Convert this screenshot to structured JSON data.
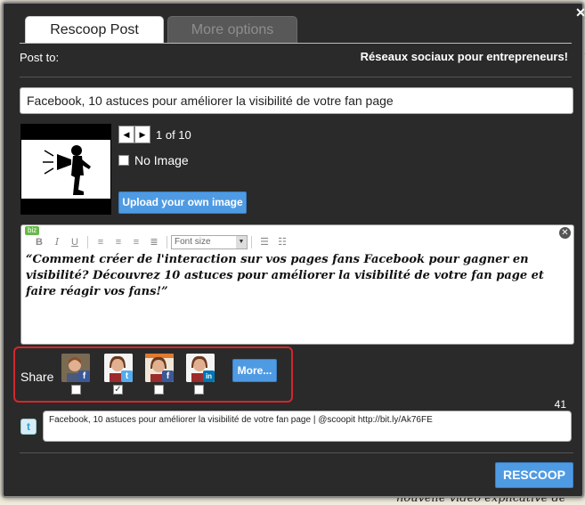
{
  "background": {
    "bottom_text": "nouvelle vidéo explicative de"
  },
  "modal": {
    "tabs": [
      {
        "label": "Rescoop Post",
        "active": true
      },
      {
        "label": "More options",
        "active": false
      }
    ],
    "post_to_label": "Post to:",
    "post_to_target": "Réseaux sociaux pour entrepreneurs!",
    "title_value": "Facebook, 10 astuces pour améliorer la visibilité de votre fan page",
    "image": {
      "counter": "1 of 10",
      "no_image_label": "No Image",
      "upload_label": "Upload your own image"
    },
    "editor": {
      "badge": "biz",
      "font_size_placeholder": "Font size",
      "content": "“Comment créer de l'interaction sur vos pages fans Facebook pour gagner en visibilité? Découvrez 10 astuces pour améliorer la visibilité de votre fan page et faire réagir vos fans!”"
    },
    "share": {
      "label": "Share",
      "accounts": [
        {
          "network": "facebook",
          "checked": false
        },
        {
          "network": "twitter",
          "checked": true
        },
        {
          "network": "facebook-page",
          "checked": false
        },
        {
          "network": "linkedin",
          "checked": false
        }
      ],
      "more_label": "More..."
    },
    "tweet": {
      "char_count": "41",
      "text": "Facebook, 10 astuces pour améliorer la visibilité de votre fan page | @scoopit http://bit.ly/Ak76FE"
    },
    "rescoop_label": "RESCOOP"
  },
  "colors": {
    "modal_bg": "#2a2a2a",
    "button_blue": "#4f9be3",
    "highlight_red": "#d4272c"
  }
}
